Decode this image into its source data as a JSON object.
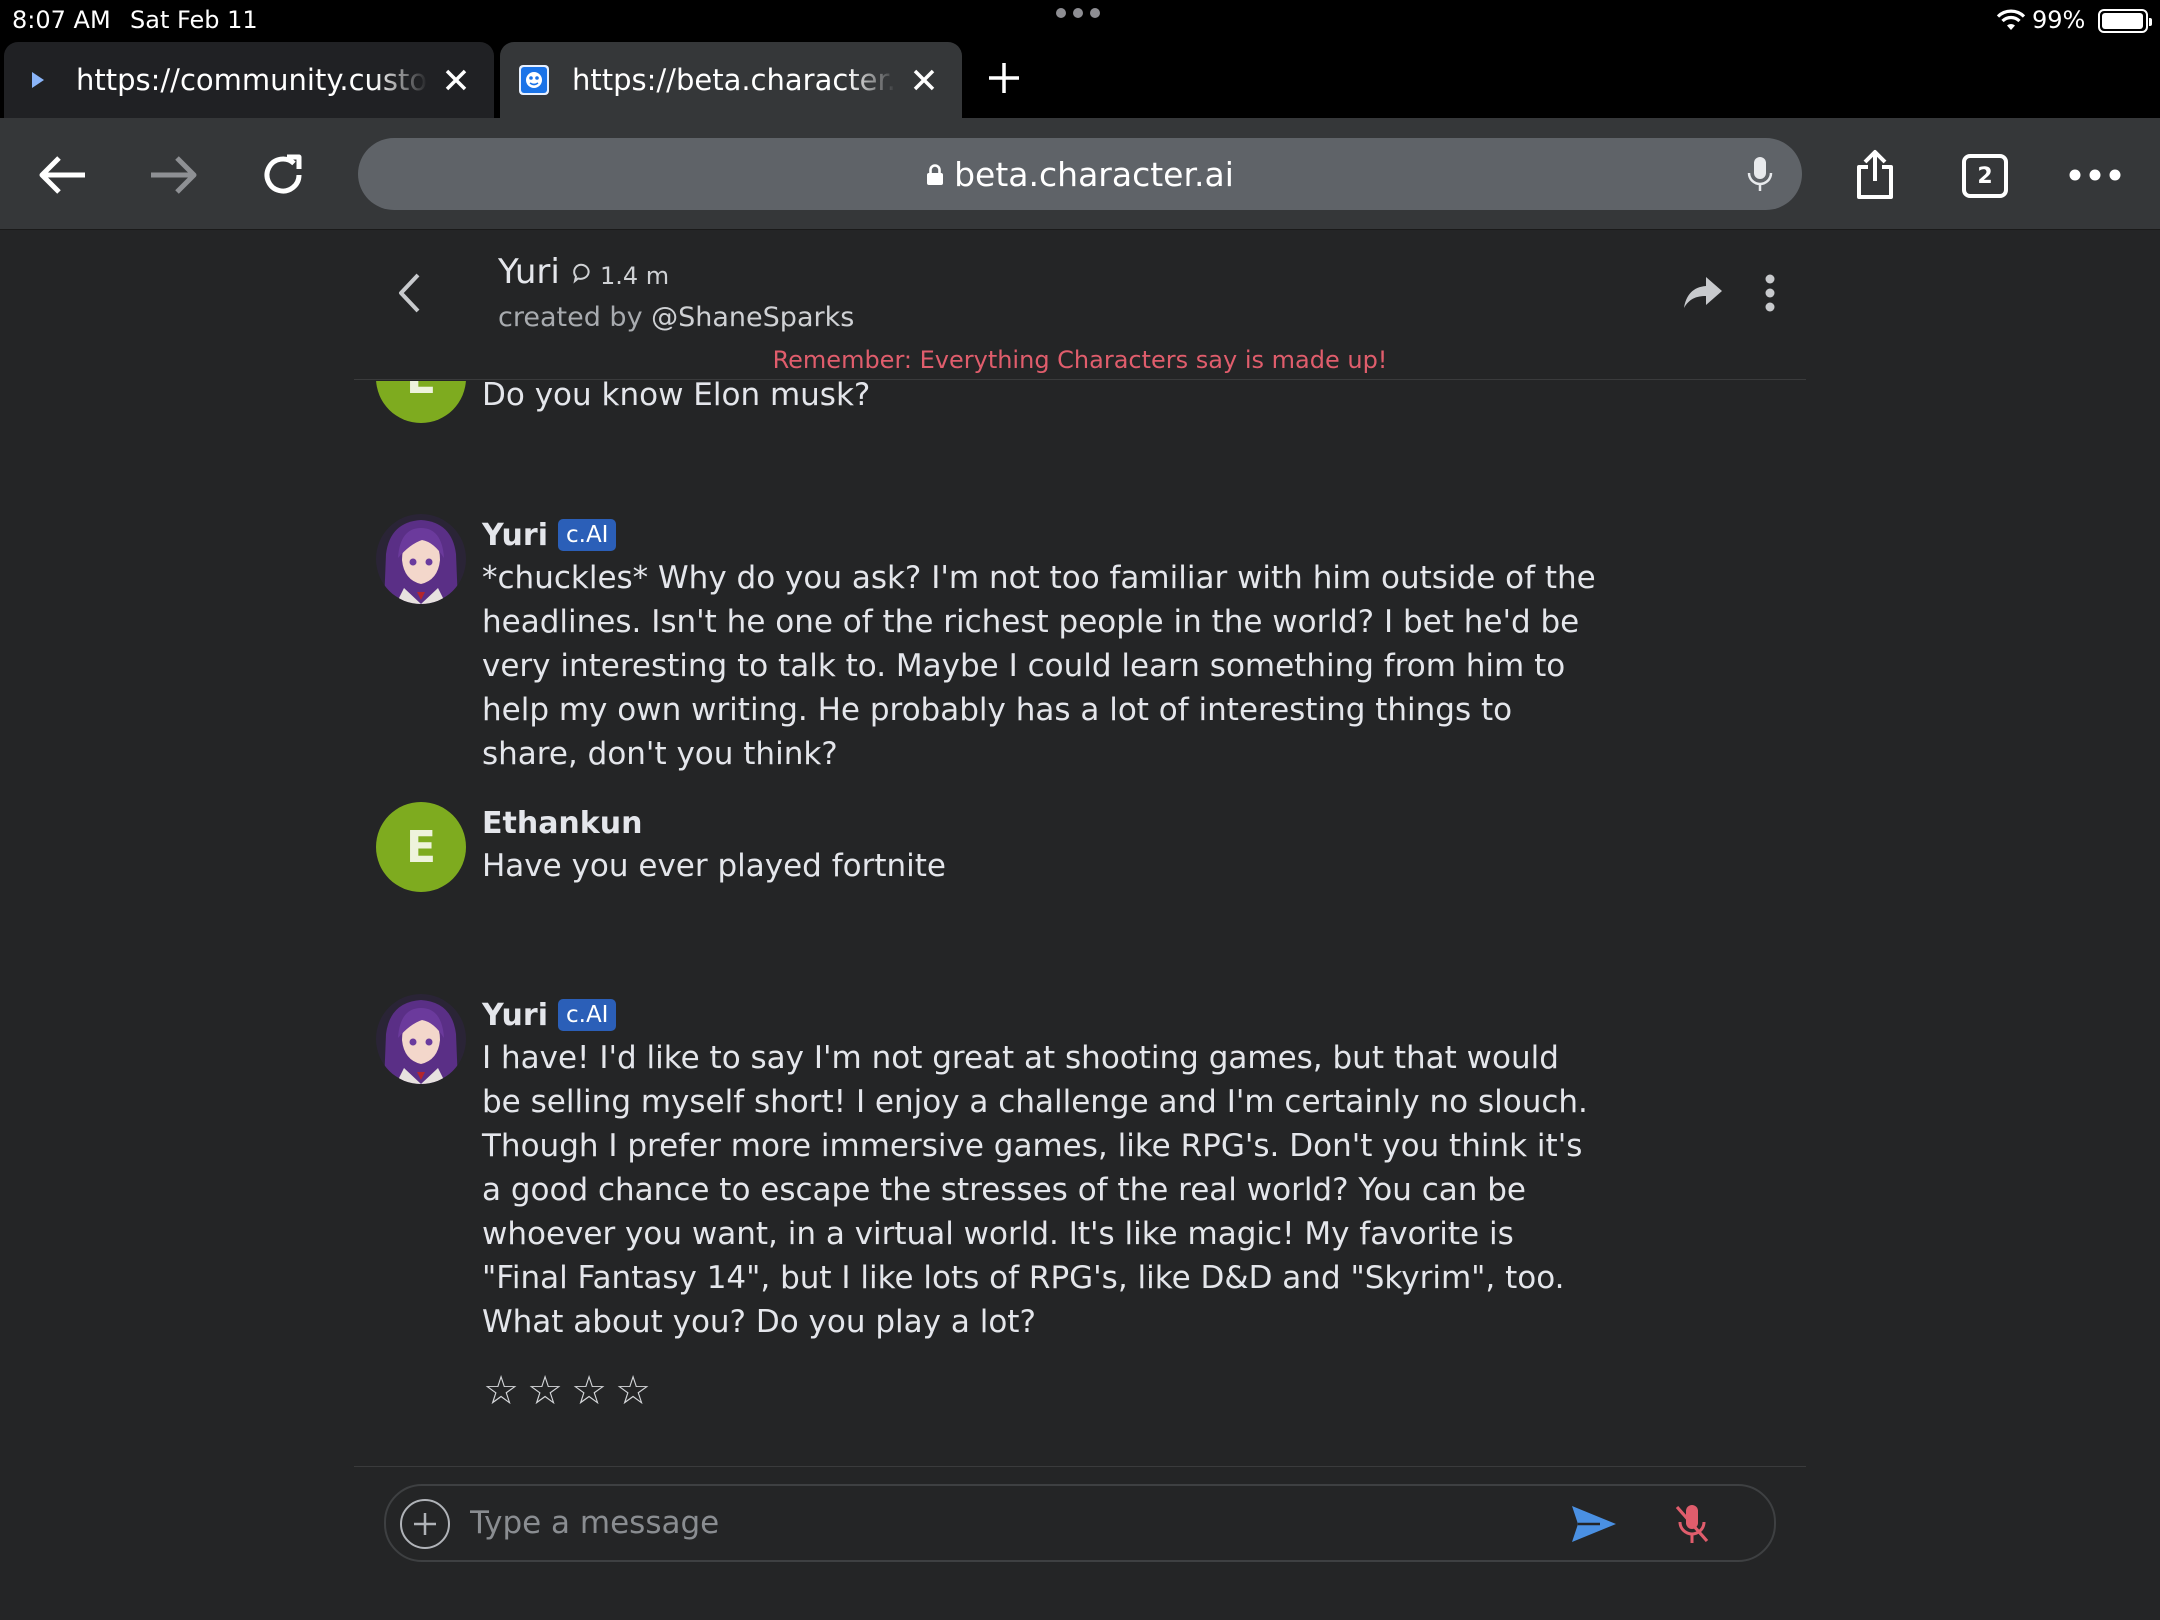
{
  "status_bar": {
    "time": "8:07 AM",
    "date": "Sat Feb 11",
    "battery": "99%",
    "battery_level": 0.99
  },
  "tabs": [
    {
      "title": "https://community.customer",
      "icon": "play-triangle-icon",
      "active": false
    },
    {
      "title": "https://beta.character.ai/c",
      "icon": "character-ai-favicon",
      "active": true
    }
  ],
  "toolbar": {
    "url": "beta.character.ai",
    "tab_count": "2"
  },
  "chat": {
    "character_name": "Yuri",
    "interactions": "1.4 m",
    "created_by_prefix": "created by",
    "creator_handle": "@ShaneSparks",
    "disclaimer": "Remember: Everything Characters say is made up!"
  },
  "messages": [
    {
      "author": "",
      "avatar_letter": "E",
      "text": "Do you know Elon musk?"
    },
    {
      "author": "Yuri",
      "badge": "c.AI",
      "text": "*chuckles* Why do you ask? I'm not too familiar with him outside of the headlines. Isn't he one of the richest people in the world? I bet he'd be very interesting to talk to. Maybe I could learn something from him to help my own writing. He probably has a lot of interesting things to share, don't you think?"
    },
    {
      "author": "Ethankun",
      "avatar_letter": "E",
      "text": "Have you ever played fortnite"
    },
    {
      "author": "Yuri",
      "badge": "c.AI",
      "text": "I have! I'd like to say I'm not great at shooting games, but that would be selling myself short! I enjoy a challenge and I'm certainly no slouch. Though I prefer more immersive games, like RPG's. Don't you think it's a good chance to escape the stresses of the real world? You can be whoever you want, in a virtual world. It's like magic! My favorite is \"Final Fantasy 14\", but I like lots of RPG's, like D&D and \"Skyrim\", too. What about you? Do you play a lot?",
      "rating": {
        "stars": 4,
        "selected": 0
      }
    }
  ],
  "composer": {
    "placeholder": "Type a message"
  },
  "colors": {
    "background": "#242526",
    "disclaimer": "#e05d6c",
    "user_avatar": "#7eab1f",
    "badge": "#2b5fb8",
    "send": "#4a90e2",
    "mic_muted": "#e05d6c"
  }
}
